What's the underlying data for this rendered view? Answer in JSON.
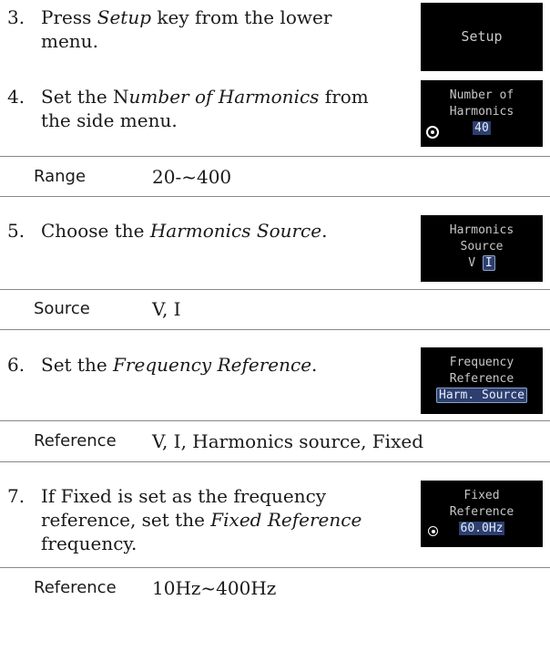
{
  "steps": [
    {
      "num": "3.",
      "line1_pre": "Press ",
      "line1_em": "Setup",
      "line1_post": " key from the lower",
      "line2": "menu."
    },
    {
      "num": "4.",
      "line1_pre": "Set the N",
      "line1_em": "umber of Harmonics",
      "line1_post": " from",
      "line2": "the side menu."
    },
    {
      "num": "5.",
      "line1_pre": "Choose the ",
      "line1_em": "Harmonics Source",
      "line1_post": "."
    },
    {
      "num": "6.",
      "line1_pre": "Set the ",
      "line1_em": "Frequency Reference",
      "line1_post": "."
    },
    {
      "num": "7.",
      "line1": "If Fixed is set as the frequency",
      "line2_pre": "reference, set the ",
      "line2_em": "Fixed Reference",
      "line3": "frequency."
    }
  ],
  "params": [
    {
      "label": "Range",
      "value": "20-~400"
    },
    {
      "label": "Source",
      "value": "V, I"
    },
    {
      "label": "Reference",
      "value": "V, I, Harmonics source, Fixed"
    },
    {
      "label": "Reference",
      "value": "10Hz~400Hz"
    }
  ],
  "buttons": {
    "setup": {
      "label": "Setup"
    },
    "harmonics_count": {
      "line1": "Number of",
      "line2": "Harmonics",
      "value": "40"
    },
    "harmonics_source": {
      "line1": "Harmonics",
      "line2": "Source",
      "opt1": "V",
      "opt2": "I"
    },
    "freq_reference": {
      "line1": "Frequency",
      "line2": "Reference",
      "value": "Harm. Source"
    },
    "fixed_reference": {
      "line1": "Fixed",
      "line2": "Reference",
      "value": "60.0Hz"
    }
  },
  "icons": {
    "knob": "variable-knob-icon"
  },
  "colors": {
    "button_bg": "#000000",
    "button_text": "#c8c8c8",
    "highlight": "#2c3f6e",
    "rule": "#888888"
  }
}
